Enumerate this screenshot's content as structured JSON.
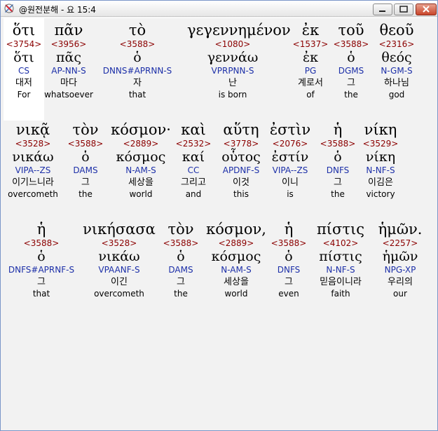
{
  "window": {
    "title": "@원전분해 - 요 15:4",
    "controls": {
      "minimize": "minimize",
      "maximize": "maximize",
      "close": "close"
    }
  },
  "lines": [
    {
      "words": [
        {
          "greek": "ὅτι",
          "strong": "<3754>",
          "lemma": "ὅτι",
          "morph": "CS",
          "korean": "대저",
          "english": "For",
          "highlighted": true
        },
        {
          "greek": "πᾶν",
          "strong": "<3956>",
          "lemma": "πᾶς",
          "morph": "AP-NN-S",
          "korean": "마다",
          "english": "whatsoever"
        },
        {
          "greek": "τὸ",
          "strong": "<3588>",
          "lemma": "ὁ",
          "morph": "DNNS#APRNN-S",
          "korean": "자",
          "english": "that"
        },
        {
          "greek": "γεγεννημένον",
          "strong": "<1080>",
          "lemma": "γεννάω",
          "morph": "VPRPNN-S",
          "korean": "난",
          "english": "is born"
        },
        {
          "greek": "ἐκ",
          "strong": "<1537>",
          "lemma": "ἐκ",
          "morph": "PG",
          "korean": "계로서",
          "english": "of"
        },
        {
          "greek": "τοῦ",
          "strong": "<3588>",
          "lemma": "ὁ",
          "morph": "DGMS",
          "korean": "그",
          "english": "the"
        },
        {
          "greek": "θεοῦ",
          "strong": "<2316>",
          "lemma": "θεός",
          "morph": "N-GM-S",
          "korean": "하나님",
          "english": "god"
        }
      ]
    },
    {
      "words": [
        {
          "greek": "νικᾷ",
          "strong": "<3528>",
          "lemma": "νικάω",
          "morph": "VIPA--ZS",
          "korean": "이기느니라",
          "english": "overcometh"
        },
        {
          "greek": "τὸν",
          "strong": "<3588>",
          "lemma": "ὁ",
          "morph": "DAMS",
          "korean": "그",
          "english": "the"
        },
        {
          "greek": "κόσμον·",
          "strong": "<2889>",
          "lemma": "κόσμος",
          "morph": "N-AM-S",
          "korean": "세상을",
          "english": "world"
        },
        {
          "greek": "καὶ",
          "strong": "<2532>",
          "lemma": "καί",
          "morph": "CC",
          "korean": "그리고",
          "english": "and"
        },
        {
          "greek": "αὕτη",
          "strong": "<3778>",
          "lemma": "οὗτος",
          "morph": "APDNF-S",
          "korean": "이것",
          "english": "this"
        },
        {
          "greek": "ἐστὶν",
          "strong": "<2076>",
          "lemma": "ἐστίν",
          "morph": "VIPA--ZS",
          "korean": "이니",
          "english": "is"
        },
        {
          "greek": "ἡ",
          "strong": "<3588>",
          "lemma": "ὁ",
          "morph": "DNFS",
          "korean": "그",
          "english": "the"
        },
        {
          "greek": "νίκη",
          "strong": "<3529>",
          "lemma": "νίκη",
          "morph": "N-NF-S",
          "korean": "이김은",
          "english": "victory"
        }
      ]
    },
    {
      "words": [
        {
          "greek": "ἡ",
          "strong": "<3588>",
          "lemma": "ὁ",
          "morph": "DNFS#APRNF-S",
          "korean": "그",
          "english": "that"
        },
        {
          "greek": "νικήσασα",
          "strong": "<3528>",
          "lemma": "νικάω",
          "morph": "VPAANF-S",
          "korean": "이긴",
          "english": "overcometh"
        },
        {
          "greek": "τὸν",
          "strong": "<3588>",
          "lemma": "ὁ",
          "morph": "DAMS",
          "korean": "그",
          "english": "the"
        },
        {
          "greek": "κόσμον,",
          "strong": "<2889>",
          "lemma": "κόσμος",
          "morph": "N-AM-S",
          "korean": "세상을",
          "english": "world"
        },
        {
          "greek": "ἡ",
          "strong": "<3588>",
          "lemma": "ὁ",
          "morph": "DNFS",
          "korean": "그",
          "english": "even"
        },
        {
          "greek": "πίστις",
          "strong": "<4102>",
          "lemma": "πίστις",
          "morph": "N-NF-S",
          "korean": "믿음이니라",
          "english": "faith"
        },
        {
          "greek": "ἡμῶν.",
          "strong": "<2257>",
          "lemma": "ἡμῶν",
          "morph": "NPG-XP",
          "korean": "우리의",
          "english": "our"
        }
      ]
    }
  ],
  "colors": {
    "strong": "#8b0000",
    "morph": "#1c2fa8",
    "background": "#f2f2f2",
    "highlight": "#ffffff"
  }
}
